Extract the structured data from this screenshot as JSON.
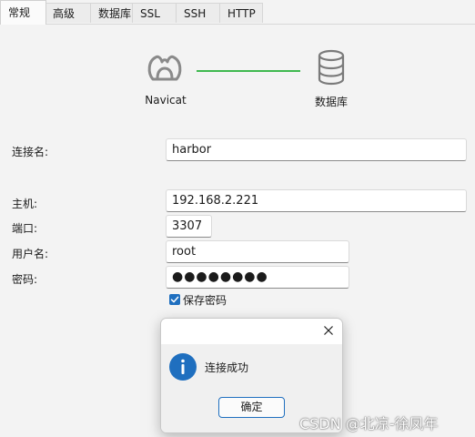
{
  "tabs": [
    {
      "label": "常规",
      "active": true
    },
    {
      "label": "高级"
    },
    {
      "label": "数据库"
    },
    {
      "label": "SSL"
    },
    {
      "label": "SSH"
    },
    {
      "label": "HTTP"
    }
  ],
  "diagram": {
    "left_label": "Navicat",
    "right_label": "数据库",
    "line_color": "#3fb950",
    "left_icon": "navicat-logo-icon",
    "right_icon": "database-icon"
  },
  "form": {
    "connection_name": {
      "label": "连接名:",
      "value": "harbor"
    },
    "host": {
      "label": "主机:",
      "value": "192.168.2.221"
    },
    "port": {
      "label": "端口:",
      "value": "3307"
    },
    "username": {
      "label": "用户名:",
      "value": "root"
    },
    "password": {
      "label": "密码:",
      "value": "●●●●●●●●"
    },
    "save_password": {
      "label": "保存密码",
      "checked": true
    }
  },
  "dialog": {
    "message": "连接成功",
    "ok_label": "确定",
    "icon": "info-icon",
    "close_icon": "close-icon"
  },
  "watermark": "CSDN @北凉-徐凤年",
  "colors": {
    "accent": "#1f6fbf",
    "connection_line": "#3fb950"
  }
}
